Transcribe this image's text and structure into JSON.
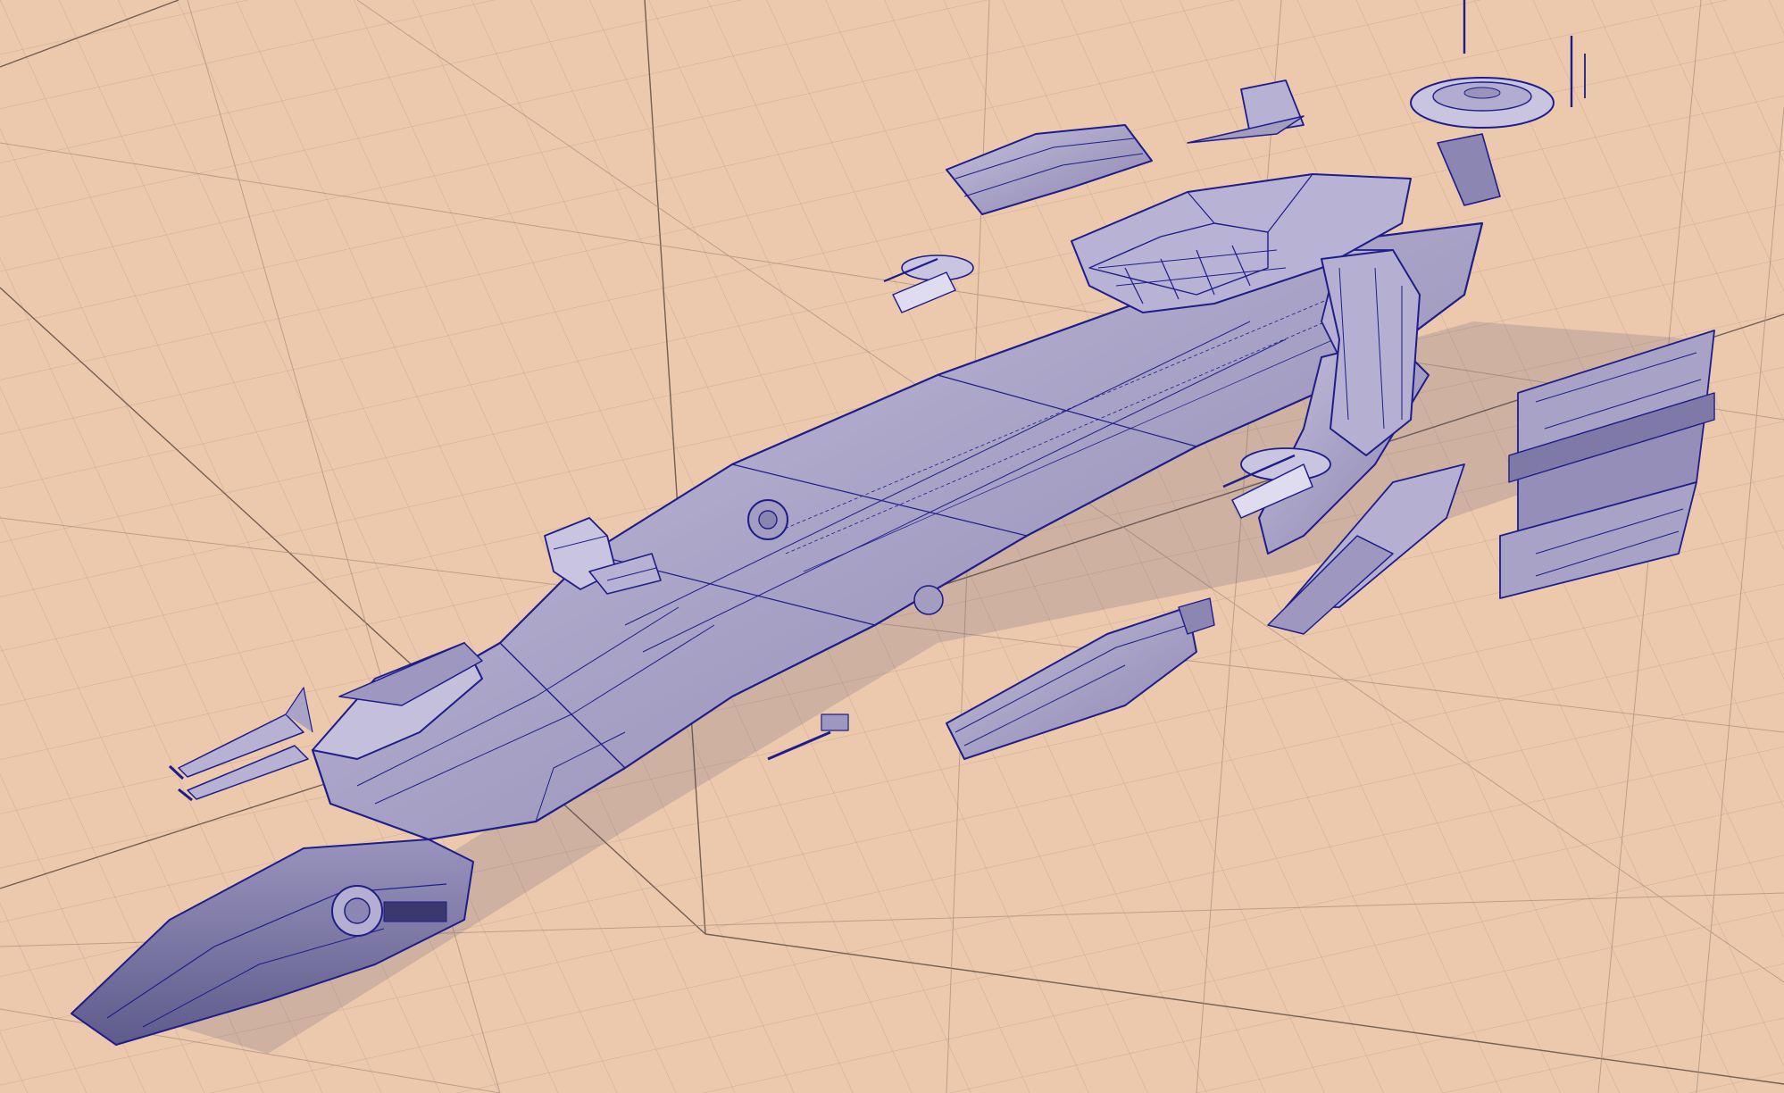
{
  "scene": {
    "kind": "3d-wireframe-viewport",
    "subject": "spaceship-model",
    "background_color": "#ecc9ad",
    "minor_grid_color": "#c9a98f",
    "major_grid_color": "#5f4d44",
    "hull_fill_color": "#a9a3c6",
    "hull_light_color": "#c4bfdb",
    "hull_dark_color": "#7e78a6",
    "wire_color": "#1d1d8c",
    "shadow_color": "#4a4670"
  }
}
